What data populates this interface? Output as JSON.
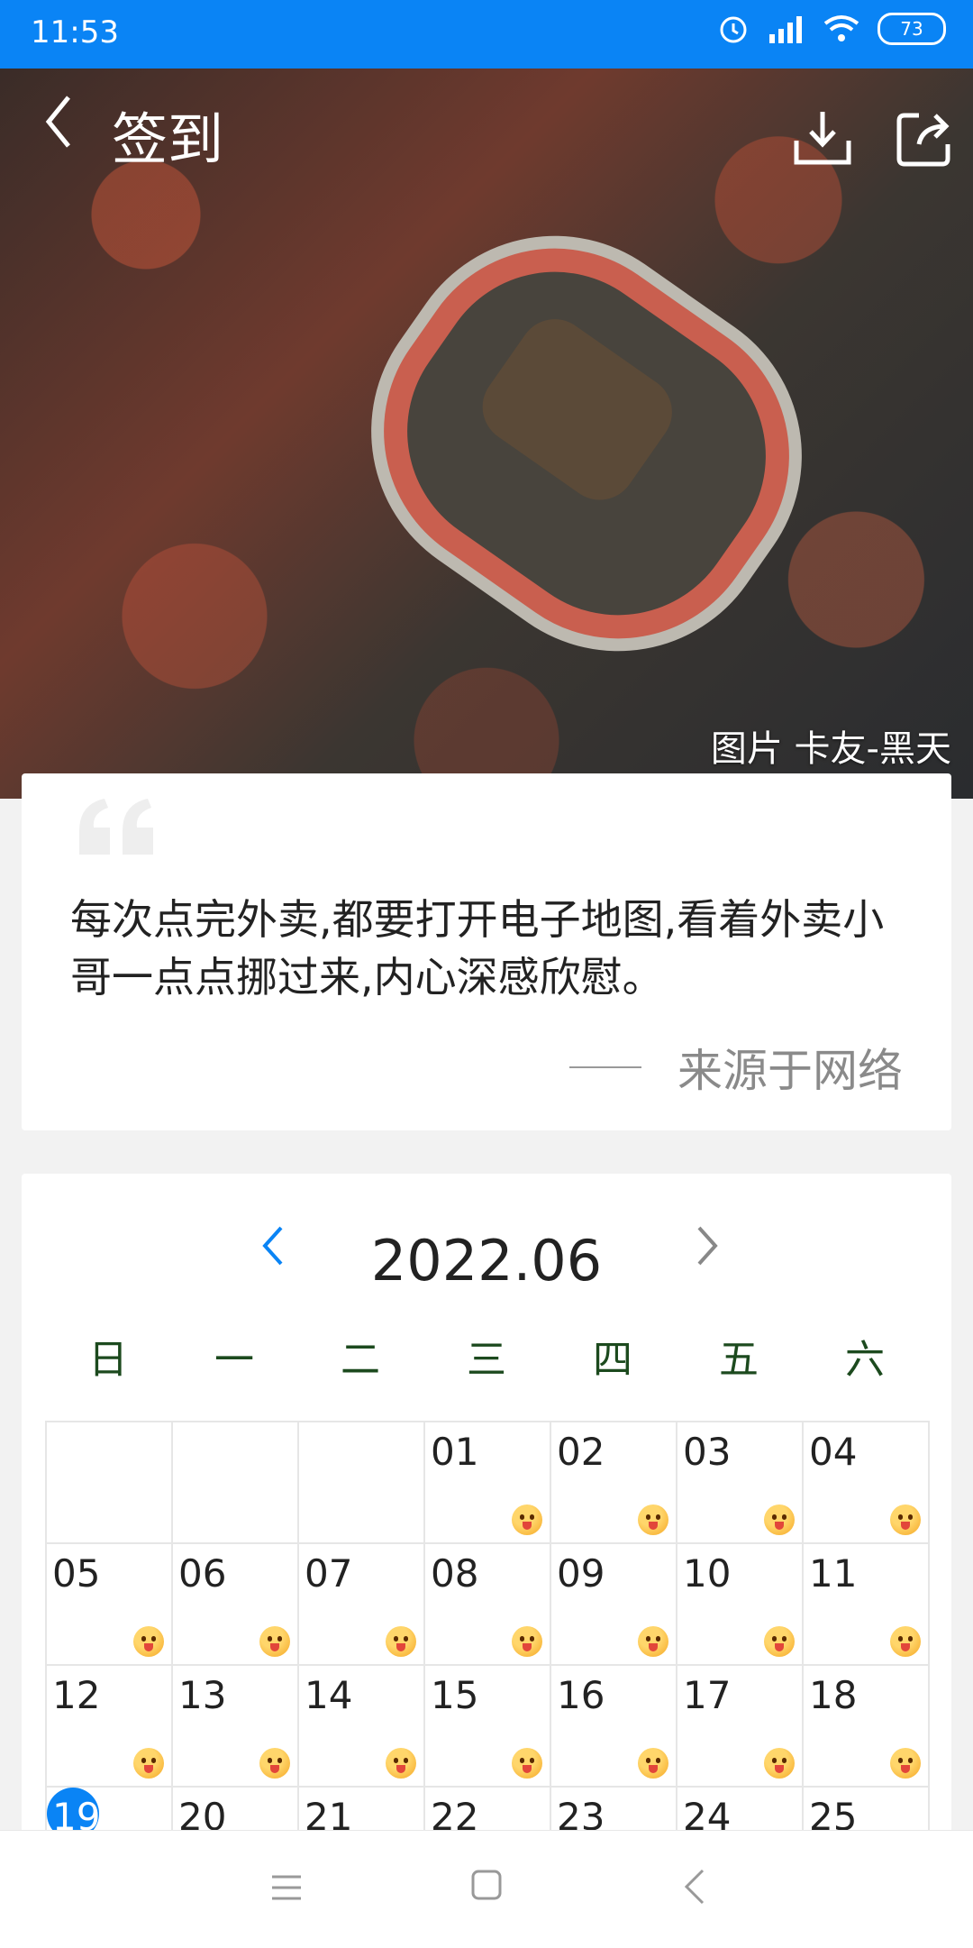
{
  "status_bar": {
    "time": "11:53",
    "battery": "73",
    "icons": [
      "alarm-icon",
      "signal-icon",
      "wifi-icon",
      "battery-icon"
    ]
  },
  "header": {
    "title": "签到",
    "back_icon": "chevron-left-icon",
    "download_icon": "download-icon",
    "share_icon": "share-icon"
  },
  "hero": {
    "photo_credit": "图片 卡友-黑天"
  },
  "quote": {
    "text": "每次点完外卖,都要打开电子地图,看着外卖小哥一点点挪过来,内心深感欣慰。",
    "source": "来源于网络"
  },
  "calendar": {
    "title": "2022.06",
    "weekdays": [
      "日",
      "一",
      "二",
      "三",
      "四",
      "五",
      "六"
    ],
    "days": [
      {
        "label": "",
        "checked": false
      },
      {
        "label": "",
        "checked": false
      },
      {
        "label": "",
        "checked": false
      },
      {
        "label": "01",
        "checked": true
      },
      {
        "label": "02",
        "checked": true
      },
      {
        "label": "03",
        "checked": true
      },
      {
        "label": "04",
        "checked": true
      },
      {
        "label": "05",
        "checked": true
      },
      {
        "label": "06",
        "checked": true
      },
      {
        "label": "07",
        "checked": true
      },
      {
        "label": "08",
        "checked": true
      },
      {
        "label": "09",
        "checked": true
      },
      {
        "label": "10",
        "checked": true
      },
      {
        "label": "11",
        "checked": true
      },
      {
        "label": "12",
        "checked": true
      },
      {
        "label": "13",
        "checked": true
      },
      {
        "label": "14",
        "checked": true
      },
      {
        "label": "15",
        "checked": true
      },
      {
        "label": "16",
        "checked": true
      },
      {
        "label": "17",
        "checked": true
      },
      {
        "label": "18",
        "checked": true
      },
      {
        "label": "19",
        "checked": false,
        "today": true
      },
      {
        "label": "20",
        "checked": false
      },
      {
        "label": "21",
        "checked": false
      },
      {
        "label": "22",
        "checked": false
      },
      {
        "label": "23",
        "checked": false
      },
      {
        "label": "24",
        "checked": false
      },
      {
        "label": "25",
        "checked": false
      }
    ]
  },
  "colors": {
    "accent": "#0a84f5",
    "weekday": "#1c4a1e"
  }
}
